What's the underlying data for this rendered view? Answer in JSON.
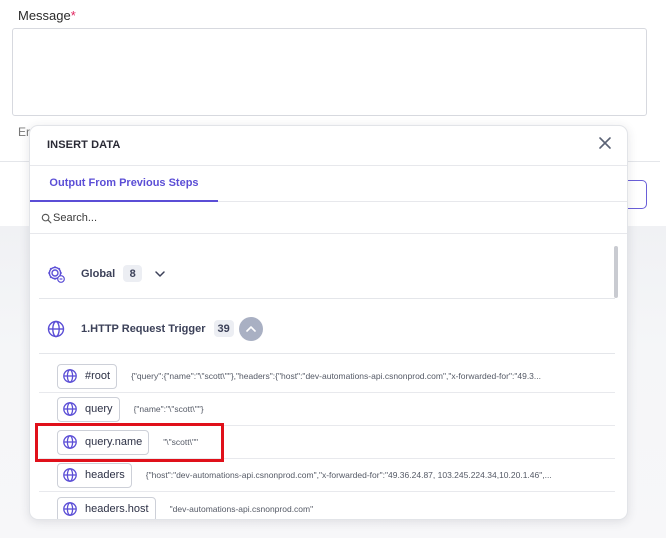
{
  "form": {
    "message_label": "Message",
    "required_mark": "*",
    "hint_text": "Er"
  },
  "panel": {
    "title": "INSERT DATA",
    "tab_label": "Output From Previous Steps",
    "search_placeholder": "Search...",
    "groups": [
      {
        "label": "Global",
        "count": "8",
        "expanded": false
      },
      {
        "label": "1.HTTP Request Trigger",
        "count": "39",
        "expanded": true
      }
    ],
    "rows": [
      {
        "key": "#root",
        "value": "{\"query\":{\"name\":\"\\\"scott\\\"\"},\"headers\":{\"host\":\"dev-automations-api.csnonprod.com\",\"x-forwarded-for\":\"49.3..."
      },
      {
        "key": "query",
        "value": "{\"name\":\"\\\"scott\\\"\"}"
      },
      {
        "key": "query.name",
        "value": "\"\\\"scott\\\"\""
      },
      {
        "key": "headers",
        "value": "{\"host\":\"dev-automations-api.csnonprod.com\",\"x-forwarded-for\":\"49.36.24.87, 103.245.224.34,10.20.1.46\",..."
      },
      {
        "key": "headers.host",
        "value": "\"dev-automations-api.csnonprod.com\""
      }
    ]
  },
  "colors": {
    "accent": "#5b4ed6",
    "highlight": "#e0101a",
    "required": "#e0245e"
  },
  "icons": {
    "close": "close-icon",
    "search": "search-icon",
    "global": "gear-icon",
    "trigger": "globe-icon",
    "chip": "globe-icon"
  }
}
